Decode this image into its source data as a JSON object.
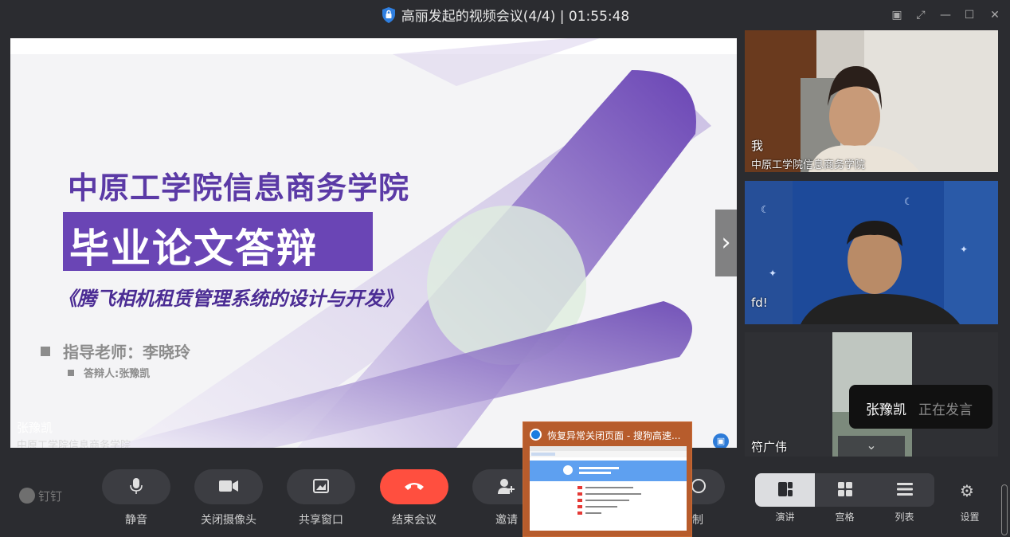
{
  "window": {
    "title": "高丽发起的视频会议(4/4) | 01:55:48"
  },
  "slide": {
    "title1": "中原工学院信息商务学院",
    "title2": "毕业论文答辩",
    "subtitle": "《腾飞相机租赁管理系统的设计与开发》",
    "teacher": "指导老师：李晓玲",
    "defender": "答辩人:张豫凯",
    "presenter_name": "张豫凯",
    "presenter_org": "中原工学院信息商务学院"
  },
  "participants": [
    {
      "name": "我",
      "org": "中原工学院信息商务学院"
    },
    {
      "name": "fd!"
    },
    {
      "name": "符广伟"
    }
  ],
  "toast": {
    "name": "张豫凯",
    "status": "正在发言"
  },
  "toolbar": {
    "brand": "钉钉",
    "mute_label": "静音",
    "camera_label": "关闭摄像头",
    "share_label": "共享窗口",
    "end_label": "结束会议",
    "invite_label": "邀请",
    "record_label_partial": "制",
    "view_present_label": "演讲",
    "view_grid_label": "宫格",
    "view_list_label": "列表",
    "settings_label": "设置"
  },
  "preview": {
    "title": "恢复异常关闭页面 - 搜狗高速..."
  },
  "colors": {
    "accent_purple": "#6a45b5",
    "end_red": "#ff4f3f",
    "dark_bg": "#2b2c30"
  }
}
